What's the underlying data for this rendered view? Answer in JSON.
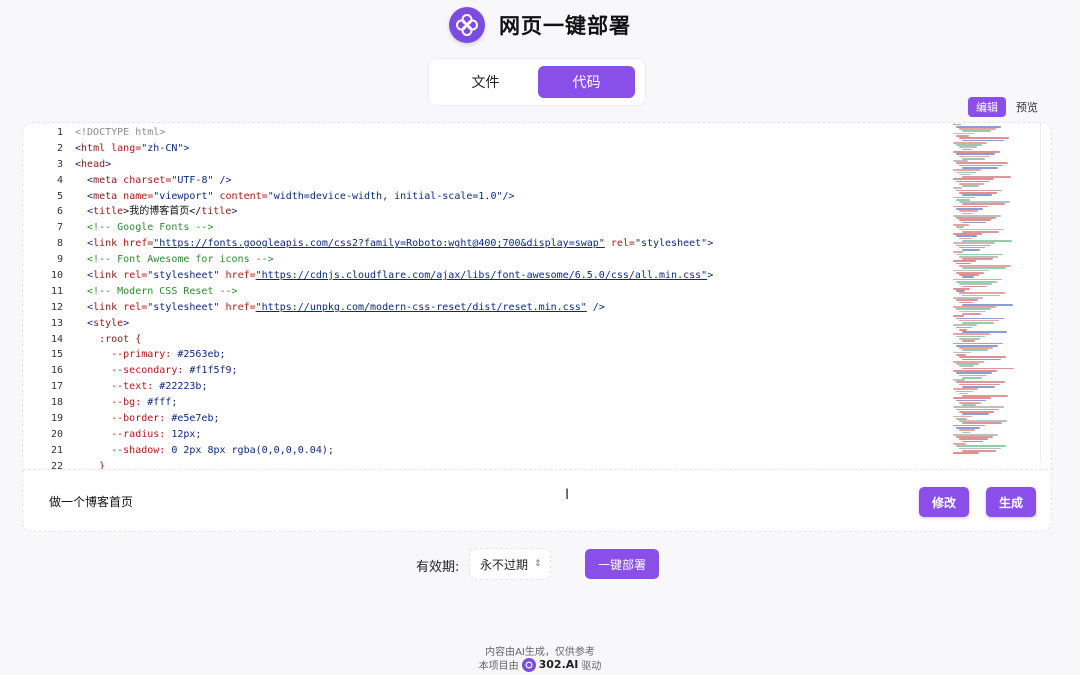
{
  "header": {
    "title": "网页一键部署",
    "logo_icon": "flower-logo-icon"
  },
  "tabs": [
    {
      "label": "文件",
      "active": false
    },
    {
      "label": "代码",
      "active": true
    }
  ],
  "mode_toggle": {
    "edit_label": "编辑",
    "preview_label": "预览"
  },
  "editor": {
    "line_numbers": [
      "1",
      "2",
      "3",
      "4",
      "5",
      "6",
      "7",
      "8",
      "9",
      "10",
      "11",
      "12",
      "13",
      "14",
      "15",
      "16",
      "17",
      "18",
      "19",
      "20",
      "21",
      "22"
    ],
    "lines": [
      [
        {
          "t": "<!DOCTYPE html>",
          "c": "#8a8a9a"
        }
      ],
      [
        {
          "t": "<",
          "c": "#0b2a80"
        },
        {
          "t": "html",
          "c": "#8b1a1a"
        },
        {
          "t": " lang=",
          "c": "#b21818"
        },
        {
          "t": "\"zh-CN\"",
          "c": "#0b2a80"
        },
        {
          "t": ">",
          "c": "#0b2a80"
        }
      ],
      [
        {
          "t": "<",
          "c": "#0b2a80"
        },
        {
          "t": "head",
          "c": "#8b1a1a"
        },
        {
          "t": ">",
          "c": "#0b2a80"
        }
      ],
      [
        {
          "t": "  <",
          "c": "#0b2a80"
        },
        {
          "t": "meta",
          "c": "#8b1a1a"
        },
        {
          "t": " charset=",
          "c": "#b21818"
        },
        {
          "t": "\"UTF-8\"",
          "c": "#0b2a80"
        },
        {
          "t": " />",
          "c": "#0b2a80"
        }
      ],
      [
        {
          "t": "  <",
          "c": "#0b2a80"
        },
        {
          "t": "meta",
          "c": "#8b1a1a"
        },
        {
          "t": " name=",
          "c": "#b21818"
        },
        {
          "t": "\"viewport\"",
          "c": "#0b2a80"
        },
        {
          "t": " content=",
          "c": "#b21818"
        },
        {
          "t": "\"width=device-width, initial-scale=1.0\"",
          "c": "#0b2a80"
        },
        {
          "t": "/>",
          "c": "#0b2a80"
        }
      ],
      [
        {
          "t": "  <",
          "c": "#0b2a80"
        },
        {
          "t": "title",
          "c": "#8b1a1a"
        },
        {
          "t": ">我的博客首页</",
          "c": "#111111"
        },
        {
          "t": "title",
          "c": "#8b1a1a"
        },
        {
          "t": ">",
          "c": "#0b2a80"
        }
      ],
      [
        {
          "t": "  <!-- Google Fonts -->",
          "c": "#2e8b2e"
        }
      ],
      [
        {
          "t": "  <",
          "c": "#0b2a80"
        },
        {
          "t": "link",
          "c": "#8b1a1a"
        },
        {
          "t": " href=",
          "c": "#b21818"
        },
        {
          "t": "\"https://fonts.googleapis.com/css2?family=Roboto:wght@400;700&display=swap\"",
          "c": "#0b2a80"
        },
        {
          "t": " rel=",
          "c": "#b21818"
        },
        {
          "t": "\"stylesheet\"",
          "c": "#0b2a80"
        },
        {
          "t": ">",
          "c": "#0b2a80"
        }
      ],
      [
        {
          "t": "  <!-- Font Awesome for icons -->",
          "c": "#2e8b2e"
        }
      ],
      [
        {
          "t": "  <",
          "c": "#0b2a80"
        },
        {
          "t": "link",
          "c": "#8b1a1a"
        },
        {
          "t": " rel=",
          "c": "#b21818"
        },
        {
          "t": "\"stylesheet\"",
          "c": "#0b2a80"
        },
        {
          "t": " href=",
          "c": "#b21818"
        },
        {
          "t": "\"https://cdnjs.cloudflare.com/ajax/libs/font-awesome/6.5.0/css/all.min.css\"",
          "c": "#0b2a80"
        },
        {
          "t": ">",
          "c": "#0b2a80"
        }
      ],
      [
        {
          "t": "  <!-- Modern CSS Reset -->",
          "c": "#2e8b2e"
        }
      ],
      [
        {
          "t": "  <",
          "c": "#0b2a80"
        },
        {
          "t": "link",
          "c": "#8b1a1a"
        },
        {
          "t": " rel=",
          "c": "#b21818"
        },
        {
          "t": "\"stylesheet\"",
          "c": "#0b2a80"
        },
        {
          "t": " href=",
          "c": "#b21818"
        },
        {
          "t": "\"https://unpkg.com/modern-css-reset/dist/reset.min.css\"",
          "c": "#0b2a80"
        },
        {
          "t": " />",
          "c": "#0b2a80"
        }
      ],
      [
        {
          "t": "  <",
          "c": "#0b2a80"
        },
        {
          "t": "style",
          "c": "#8b1a1a"
        },
        {
          "t": ">",
          "c": "#0b2a80"
        }
      ],
      [
        {
          "t": "    :root {",
          "c": "#8b1a1a"
        }
      ],
      [
        {
          "t": "      --primary: ",
          "c": "#b21818"
        },
        {
          "t": "#2563eb;",
          "c": "#0b2a80"
        }
      ],
      [
        {
          "t": "      --secondary: ",
          "c": "#b21818"
        },
        {
          "t": "#f1f5f9;",
          "c": "#0b2a80"
        }
      ],
      [
        {
          "t": "      --text: ",
          "c": "#b21818"
        },
        {
          "t": "#22223b;",
          "c": "#0b2a80"
        }
      ],
      [
        {
          "t": "      --bg: ",
          "c": "#b21818"
        },
        {
          "t": "#fff;",
          "c": "#0b2a80"
        }
      ],
      [
        {
          "t": "      --border: ",
          "c": "#b21818"
        },
        {
          "t": "#e5e7eb;",
          "c": "#0b2a80"
        }
      ],
      [
        {
          "t": "      --radius: ",
          "c": "#b21818"
        },
        {
          "t": "12px;",
          "c": "#0b2a80"
        }
      ],
      [
        {
          "t": "      --shadow: ",
          "c": "#b21818"
        },
        {
          "t": "0 2px 8px rgba(0,0,0,0.04);",
          "c": "#0b2a80"
        }
      ],
      [
        {
          "t": "    }",
          "c": "#8b1a1a"
        }
      ]
    ]
  },
  "prompt": {
    "text": "做一个博客首页"
  },
  "actions": {
    "modify_label": "修改",
    "generate_label": "生成"
  },
  "deploy": {
    "expiry_label": "有效期:",
    "expiry_value": "永不过期",
    "deploy_label": "一键部署"
  },
  "footer": {
    "line1": "内容由AI生成，仅供参考",
    "prefix": "本项目由",
    "brand": "302.AI",
    "suffix": "驱动"
  },
  "colors": {
    "accent": "#8a4fe8",
    "background": "#f8f8fb"
  }
}
